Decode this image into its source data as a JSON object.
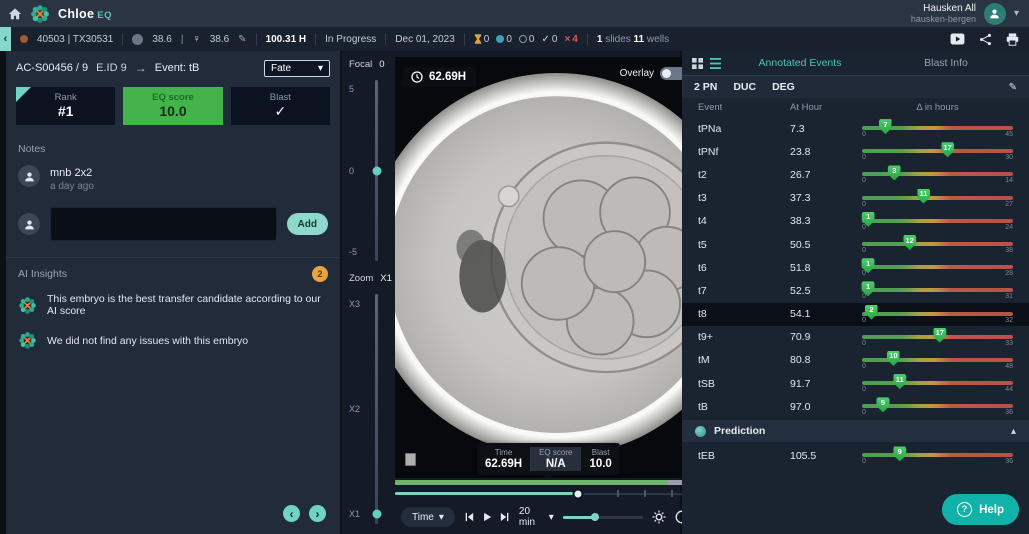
{
  "app": {
    "brand": "Chloe",
    "brand_suffix": "EQ",
    "user": {
      "name": "Hausken All",
      "org": "hausken-bergen"
    }
  },
  "toolbar": {
    "sample_id": "40503 | TX30531",
    "temp_a": "38.6",
    "temp_b": "38.6",
    "elapsed": "100.31 H",
    "status": "In Progress",
    "date": "Dec 01, 2023",
    "counts": [
      {
        "icon": "hourglass",
        "value": "0"
      },
      {
        "icon": "dot",
        "value": "0"
      },
      {
        "icon": "ring",
        "value": "0"
      },
      {
        "icon": "check",
        "value": "0"
      },
      {
        "icon": "cross",
        "value": "4"
      }
    ],
    "slides": {
      "count": "1",
      "label": "slides"
    },
    "wells": {
      "count": "11",
      "label": "wells"
    }
  },
  "embryo_panel": {
    "id": "AC-S00456 / 9",
    "eid": "E.ID 9",
    "event": "Event: tB",
    "fate": "Fate",
    "rank_label": "Rank",
    "rank_value": "#1",
    "score_label": "EQ score",
    "score_value": "10.0",
    "blast_label": "Blast",
    "notes_label": "Notes",
    "comment": {
      "author": "mnb 2x2",
      "time": "a day ago"
    },
    "add_button": "Add",
    "ai": {
      "title": "AI Insights",
      "badge": "2",
      "items": [
        {
          "text": "This embryo is the best transfer candidate according to our AI score"
        },
        {
          "text": "We did not find any issues with this embryo"
        }
      ]
    }
  },
  "viewer": {
    "focal": {
      "label": "Focal",
      "value": "0",
      "ticks": [
        "5",
        "0",
        "-5"
      ]
    },
    "zoom": {
      "label": "Zoom",
      "value": "X1",
      "ticks": [
        "X3",
        "X2",
        "X1"
      ]
    },
    "time_badge": "62.69H",
    "overlay_label": "Overlay",
    "tooltip": {
      "time_label": "Time",
      "time_value": "62.69H",
      "score_label": "EQ score",
      "score_value": "N/A",
      "blast_label": "Blast",
      "blast_value": "10.0"
    },
    "controls": {
      "mode": "Time",
      "interval": "20 min"
    }
  },
  "events_panel": {
    "tabs": [
      {
        "label": "Annotated Events"
      },
      {
        "label": "Blast Info"
      }
    ],
    "flags": [
      "2 PN",
      "DUC",
      "DEG"
    ],
    "columns": [
      "Event",
      "At Hour",
      "Δ in hours"
    ],
    "selected_event": "t8",
    "scale_min": "0",
    "rows": [
      {
        "event": "tPNa",
        "at_hour": "7.3",
        "delta": 7,
        "max": 45
      },
      {
        "event": "tPNf",
        "at_hour": "23.8",
        "delta": 17,
        "max": 30
      },
      {
        "event": "t2",
        "at_hour": "26.7",
        "delta": 3,
        "max": 14
      },
      {
        "event": "t3",
        "at_hour": "37.3",
        "delta": 11,
        "max": 27
      },
      {
        "event": "t4",
        "at_hour": "38.3",
        "delta": 1,
        "max": 24
      },
      {
        "event": "t5",
        "at_hour": "50.5",
        "delta": 12,
        "max": 38
      },
      {
        "event": "t6",
        "at_hour": "51.8",
        "delta": 1,
        "max": 28
      },
      {
        "event": "t7",
        "at_hour": "52.5",
        "delta": 1,
        "max": 31
      },
      {
        "event": "t8",
        "at_hour": "54.1",
        "delta": 2,
        "max": 32
      },
      {
        "event": "t9+",
        "at_hour": "70.9",
        "delta": 17,
        "max": 33
      },
      {
        "event": "tM",
        "at_hour": "80.8",
        "delta": 10,
        "max": 48
      },
      {
        "event": "tSB",
        "at_hour": "91.7",
        "delta": 11,
        "max": 44
      },
      {
        "event": "tB",
        "at_hour": "97.0",
        "delta": 5,
        "max": 36
      }
    ],
    "prediction": {
      "title": "Prediction",
      "rows": [
        {
          "event": "tEB",
          "at_hour": "105.5",
          "delta": 9,
          "max": 36
        }
      ]
    }
  },
  "help_label": "Help",
  "icons": {
    "caret_down": "▾",
    "chevron_left": "‹",
    "chevron_right": "›",
    "chevron_up": "▴",
    "pencil": "✎",
    "female": "♀",
    "check": "✓",
    "cross": "×",
    "arrow_right": "→",
    "pipe": "|",
    "help_q": "?"
  },
  "colors": {
    "accent_teal": "#4fc3bc",
    "score_green": "#45b34c",
    "alert_orange": "#e8a33d",
    "danger_red": "#d95757"
  }
}
